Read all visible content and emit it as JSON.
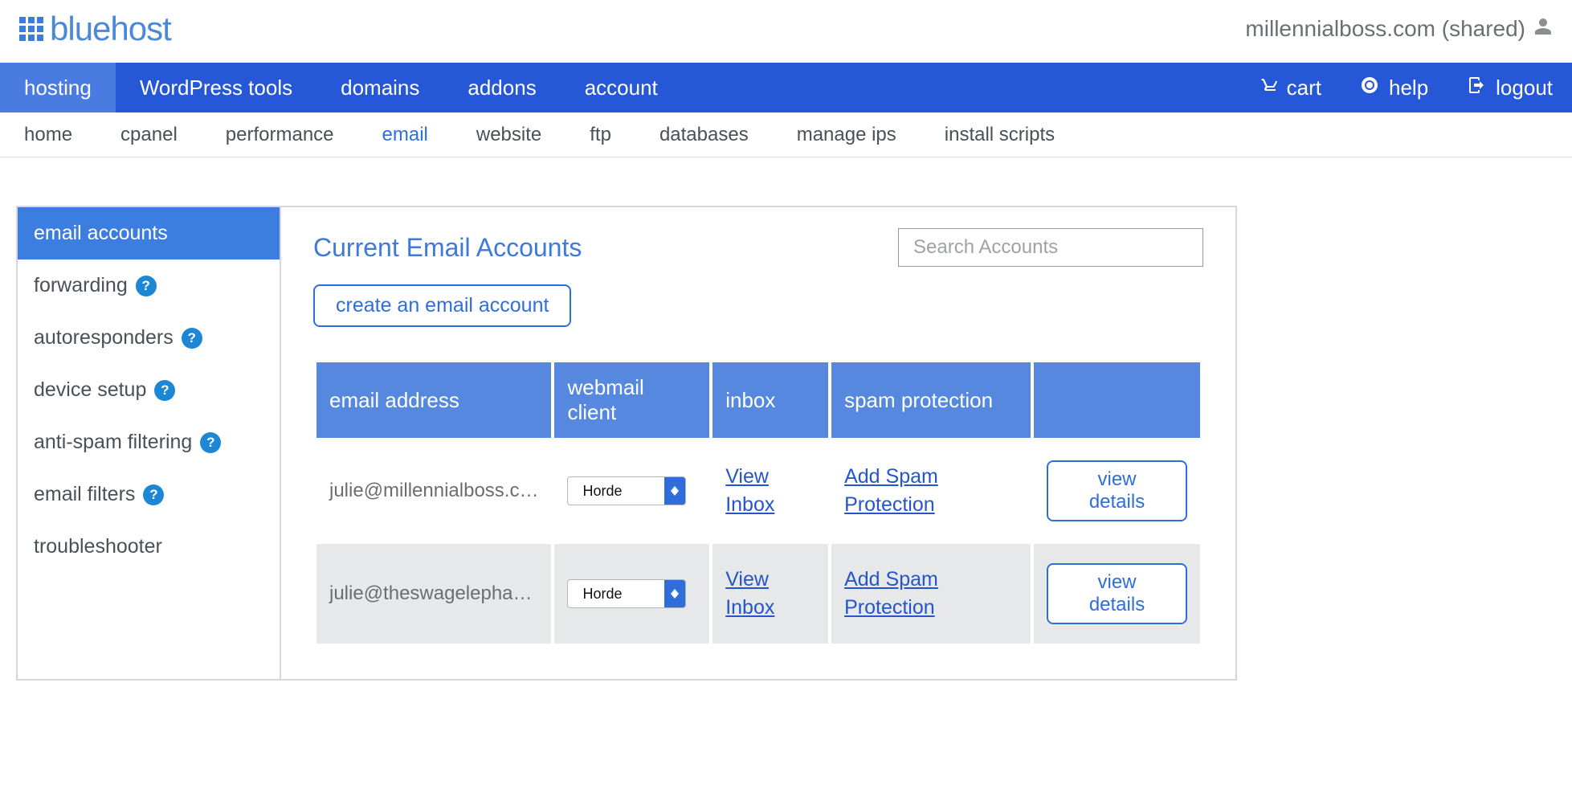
{
  "brand": {
    "name": "bluehost"
  },
  "account_label": "millennialboss.com (shared)",
  "primary_nav": {
    "items": [
      {
        "id": "hosting",
        "label": "hosting",
        "active": true
      },
      {
        "id": "wordpress",
        "label": "WordPress tools"
      },
      {
        "id": "domains",
        "label": "domains"
      },
      {
        "id": "addons",
        "label": "addons"
      },
      {
        "id": "account",
        "label": "account"
      }
    ],
    "right": {
      "cart": "cart",
      "help": "help",
      "logout": "logout"
    }
  },
  "sub_nav": {
    "items": [
      {
        "id": "home",
        "label": "home"
      },
      {
        "id": "cpanel",
        "label": "cpanel"
      },
      {
        "id": "performance",
        "label": "performance"
      },
      {
        "id": "email",
        "label": "email",
        "active": true
      },
      {
        "id": "website",
        "label": "website"
      },
      {
        "id": "ftp",
        "label": "ftp"
      },
      {
        "id": "databases",
        "label": "databases"
      },
      {
        "id": "manageips",
        "label": "manage ips"
      },
      {
        "id": "installscripts",
        "label": "install scripts"
      }
    ]
  },
  "sidebar": {
    "items": [
      {
        "id": "email-accounts",
        "label": "email accounts",
        "active": true,
        "help": false
      },
      {
        "id": "forwarding",
        "label": "forwarding",
        "help": true
      },
      {
        "id": "autoresponders",
        "label": "autoresponders",
        "help": true
      },
      {
        "id": "device-setup",
        "label": "device setup",
        "help": true
      },
      {
        "id": "anti-spam",
        "label": "anti-spam filtering",
        "help": true
      },
      {
        "id": "email-filters",
        "label": "email filters",
        "help": true
      },
      {
        "id": "troubleshooter",
        "label": "troubleshooter",
        "help": false
      }
    ]
  },
  "main": {
    "title": "Current Email Accounts",
    "search_placeholder": "Search Accounts",
    "create_label": "create an email account",
    "table": {
      "headers": {
        "email": "email address",
        "webmail": "webmail client",
        "inbox": "inbox",
        "spam": "spam protection",
        "actions": ""
      },
      "row_labels": {
        "view_inbox": "View Inbox",
        "add_spam": "Add Spam Protection",
        "view_details": "view details"
      },
      "rows": [
        {
          "email": "julie@millennialboss.c…",
          "webmail": "Horde"
        },
        {
          "email": "julie@theswagelepha…",
          "webmail": "Horde"
        }
      ]
    },
    "help_badge": "?"
  }
}
